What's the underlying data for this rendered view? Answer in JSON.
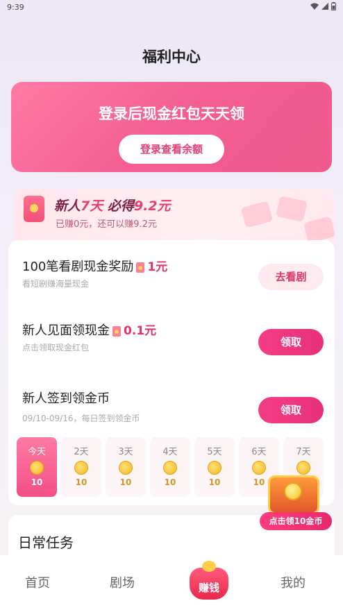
{
  "status_bar": {
    "time": "9:39"
  },
  "header": {
    "title": "福利中心"
  },
  "login_banner": {
    "title": "登录后现金红包天天领",
    "button_label": "登录查看余额"
  },
  "newbie_bonus": {
    "title_prefix": "新人",
    "title_days": "7天",
    "title_mid": " 必得",
    "title_amount": "9.2元",
    "subtitle": "已赚0元，还可以赚9.2元"
  },
  "tasks": [
    {
      "title": "100笔看剧现金奖励",
      "reward": "1元",
      "desc": "看短剧赚海量现金",
      "button": "去看剧"
    },
    {
      "title": "新人见面领现金",
      "reward": "0.1元",
      "desc": "点击领取现金红包",
      "button": "领取"
    },
    {
      "title": "新人签到领金币",
      "reward": "",
      "desc": "09/10-09/16，每日签到领金币",
      "button": "领取"
    }
  ],
  "checkin_days": [
    {
      "label": "今天",
      "amount": "10"
    },
    {
      "label": "2天",
      "amount": "10"
    },
    {
      "label": "3天",
      "amount": "10"
    },
    {
      "label": "4天",
      "amount": "10"
    },
    {
      "label": "5天",
      "amount": "10"
    },
    {
      "label": "6天",
      "amount": "10"
    },
    {
      "label": "7天",
      "amount": "10"
    }
  ],
  "treasure_chest": {
    "label": "点击领10金币"
  },
  "daily_tasks": {
    "title": "日常任务"
  },
  "tab_bar": {
    "home": "首页",
    "theater": "剧场",
    "earn": "赚钱",
    "mine": "我的"
  }
}
